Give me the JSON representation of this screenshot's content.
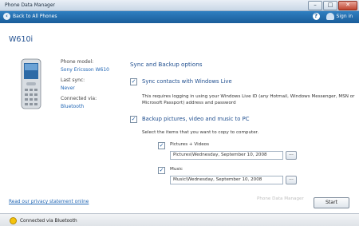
{
  "window": {
    "title": "Phone Data Manager",
    "min": "–",
    "max": "□",
    "close": "✕"
  },
  "nav": {
    "back_label": "Back to All Phones",
    "help": "?",
    "sign_in": "Sign in"
  },
  "phone": {
    "name": "W610i",
    "model_label": "Phone model:",
    "model_value": "Sony Ericsson W610",
    "sync_label": "Last sync:",
    "sync_value": "Never",
    "conn_label": "Connected via:",
    "conn_value": "Bluetooth"
  },
  "options": {
    "title": "Sync and Backup options",
    "sync_contacts": {
      "checked": true,
      "label": "Sync contacts with Windows Live",
      "desc1": "This requires logging in using your Windows Live ID (any Hotmail, Windows Messenger, MSN or",
      "desc2": "Microsoft Passport) address and password"
    },
    "backup": {
      "checked": true,
      "label": "Backup pictures, video and music to PC",
      "desc": "Select the items that you want to copy to computer.",
      "pictures_label": "Pictures + Videos",
      "pictures_checked": true,
      "pictures_path": "Pictures\\Wednesday, September 10, 2008",
      "music_label": "Music",
      "music_checked": true,
      "music_path": "Music\\Wednesday, September 10, 2008",
      "browse": "..."
    }
  },
  "footer": {
    "privacy_link": "Read our privacy statement online",
    "watermark": "Phone Data Manager",
    "start_button": "Start"
  },
  "status": {
    "text": "Connected via Bluetooth"
  }
}
